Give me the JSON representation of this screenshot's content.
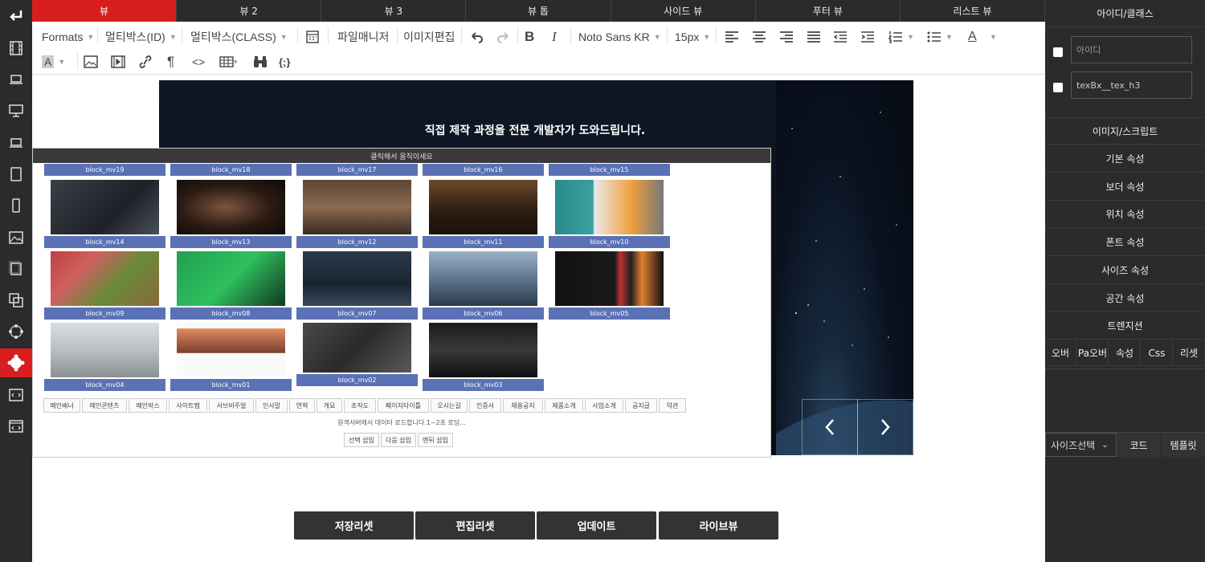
{
  "tabs": [
    "뷰",
    "뷰 2",
    "뷰 3",
    "뷰 톱",
    "사이드 뷰",
    "푸터 뷰",
    "리스트 뷰"
  ],
  "toolbar": {
    "formats": "Formats",
    "multibox_id": "멀티박스(ID)",
    "multibox_class": "멀티박스(CLASS)",
    "file_manager": "파일매니저",
    "image_edit": "이미지편집",
    "bold": "B",
    "italic": "I",
    "font_family": "Noto Sans KR",
    "font_size": "15px",
    "text_color_letter": "A",
    "bg_color_letter": "A",
    "paragraph": "¶",
    "source": "<>",
    "script": "{;}"
  },
  "canvas": {
    "heading": "직접 제작 과정을 전문 개발자가 도와드립니다."
  },
  "popup": {
    "drag_bar": "클릭해서 움직이세요",
    "top_labels": [
      "block_mv19",
      "block_mv18",
      "block_mv17",
      "block_mv16",
      "block_mv15"
    ],
    "row1": [
      "block_mv14",
      "block_mv13",
      "block_mv12",
      "block_mv11",
      "block_mv10"
    ],
    "row2": [
      "block_mv09",
      "block_mv08",
      "block_mv07",
      "block_mv06",
      "block_mv05"
    ],
    "row3": [
      "block_mv04",
      "block_mv01",
      "block_mv02",
      "block_mv03"
    ],
    "categories": [
      "메인배너",
      "메인콘텐츠",
      "메인박스",
      "사이트맵",
      "서브비주얼",
      "인사말",
      "연혁",
      "개요",
      "조직도",
      "페이지타이틀",
      "오시는길",
      "인증서",
      "채용공지",
      "제품소개",
      "사업소개",
      "공지글",
      "약관"
    ],
    "load_message": "원격서버에서 데이터 로드합니다.1~2초 로딩...",
    "insert_buttons": [
      "선택 삽입",
      "다음 삽입",
      "맨뒤 삽입"
    ]
  },
  "bottom_buttons": [
    "저장리셋",
    "편집리셋",
    "업데이트",
    "라이브뷰"
  ],
  "right_panel": {
    "header": "아이디/클래스",
    "id_placeholder": "아이디",
    "class_value": "texBx__tex_h3",
    "sections": [
      "이미지/스크립트",
      "기본 속성",
      "보더 속성",
      "위치 속성",
      "폰트 속성",
      "사이즈 속성",
      "공간 속성",
      "트렌지션"
    ],
    "sub_tabs": [
      "오버",
      "Pa오버",
      "속성",
      "Css",
      "리셋"
    ],
    "size_select": "사이즈선택",
    "code_button": "코드",
    "template_button": "템플릿"
  },
  "colors": {
    "accent_red": "#d81e1e",
    "dark_bg": "#2b2b2b",
    "thumb_label_blue": "#5a72b5"
  }
}
